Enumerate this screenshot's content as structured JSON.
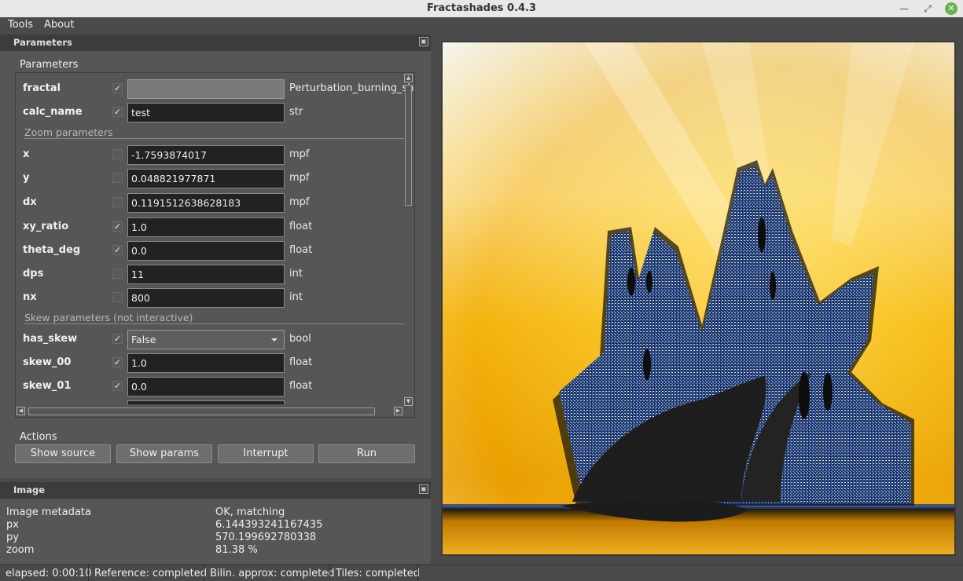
{
  "window": {
    "title": "Fractashades 0.4.3"
  },
  "menu": {
    "tools": "Tools",
    "about": "About"
  },
  "parameters_dock": {
    "title": "Parameters",
    "group_label": "Parameters",
    "rows": {
      "fractal": {
        "name": "fractal",
        "checked": true,
        "value": "",
        "type": "Perturbation_burning_sh"
      },
      "calc_name": {
        "name": "calc_name",
        "checked": true,
        "value": "test",
        "type": "str"
      },
      "x": {
        "name": "x",
        "checked": false,
        "value": "-1.7593874017",
        "type": "mpf"
      },
      "y": {
        "name": "y",
        "checked": false,
        "value": "0.048821977871",
        "type": "mpf"
      },
      "dx": {
        "name": "dx",
        "checked": false,
        "value": "0.1191512638628183",
        "type": "mpf"
      },
      "xy_ratio": {
        "name": "xy_ratio",
        "checked": true,
        "value": "1.0",
        "type": "float"
      },
      "theta_deg": {
        "name": "theta_deg",
        "checked": true,
        "value": "0.0",
        "type": "float"
      },
      "dps": {
        "name": "dps",
        "checked": false,
        "value": "11",
        "type": "int"
      },
      "nx": {
        "name": "nx",
        "checked": false,
        "value": "800",
        "type": "int"
      },
      "has_skew": {
        "name": "has_skew",
        "checked": true,
        "value": "False",
        "type": "bool"
      },
      "skew_00": {
        "name": "skew_00",
        "checked": true,
        "value": "1.0",
        "type": "float"
      },
      "skew_01": {
        "name": "skew_01",
        "checked": true,
        "value": "0.0",
        "type": "float"
      }
    },
    "sections": {
      "zoom": "Zoom parameters",
      "skew": "Skew parameters (not interactive)"
    },
    "actions_label": "Actions",
    "buttons": {
      "show_source": "Show source",
      "show_params": "Show params",
      "interrupt": "Interrupt",
      "run": "Run"
    }
  },
  "image_dock": {
    "title": "Image",
    "metadata": [
      {
        "key": "Image metadata",
        "value": "OK, matching"
      },
      {
        "key": "px",
        "value": "6.144393241167435"
      },
      {
        "key": "py",
        "value": "570.199692780338"
      },
      {
        "key": "zoom",
        "value": "81.38 %"
      }
    ]
  },
  "statusbar": {
    "elapsed": "elapsed: 0:00:10",
    "reference": "Reference: completed",
    "bilin": "Bilin. approx: completed",
    "tiles": "Tiles: completed"
  },
  "icons": {
    "minimize": "minimize-icon",
    "restore": "restore-icon",
    "close": "close-icon",
    "float": "dock-float-icon",
    "check": "checkmark-icon"
  },
  "colors": {
    "accent_close": "#6ab04c",
    "fractal_bg_top": "#ffffff",
    "fractal_bg_mid": "#f6b400",
    "fractal_shape": "#1c1c1c",
    "fractal_edge": "#2a50a0"
  }
}
